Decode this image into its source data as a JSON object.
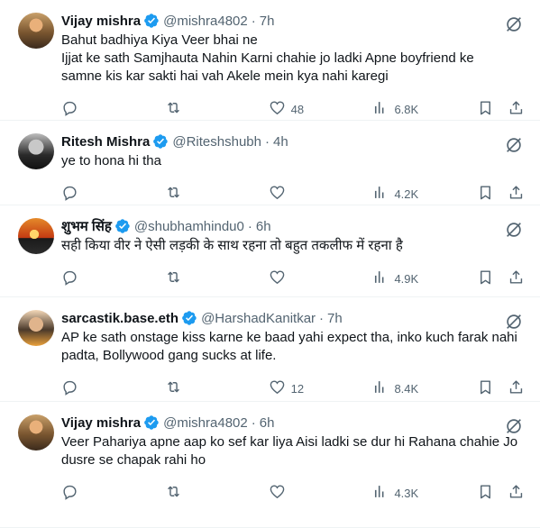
{
  "colors": {
    "accent": "#1d9bf0",
    "muted": "#536471",
    "text": "#0f1419",
    "divider": "#eff3f4"
  },
  "tweets": [
    {
      "name": "Vijay mishra",
      "handle": "@mishra4802",
      "dot": "·",
      "time": "7h",
      "lines": [
        "Bahut badhiya Kiya Veer bhai ne",
        "Ijjat ke sath Samjhauta Nahin Karni chahie jo ladki Apne boyfriend ke",
        "samne kis kar sakti hai vah Akele mein kya nahi karegi"
      ],
      "likes": "48",
      "views": "6.8K"
    },
    {
      "name": "Ritesh Mishra",
      "handle": "@Riteshshubh",
      "dot": "·",
      "time": "4h",
      "lines": [
        "ye to hona hi tha"
      ],
      "likes": "",
      "views": "4.2K"
    },
    {
      "name": "शुभम सिंह",
      "handle": "@shubhamhindu0",
      "dot": "·",
      "time": "6h",
      "lines": [
        "सही किया वीर ने ऐसी लड़की के साथ रहना तो बहुत तकलीफ में रहना है"
      ],
      "likes": "",
      "views": "4.9K"
    },
    {
      "name": "sarcastik.base.eth",
      "handle": "@HarshadKanitkar",
      "dot": "·",
      "time": "7h",
      "lines": [
        "AP ke sath onstage kiss karne ke baad yahi expect tha, inko kuch farak nahi",
        "padta, Bollywood gang sucks at life."
      ],
      "likes": "12",
      "views": "8.4K"
    },
    {
      "name": "Vijay mishra",
      "handle": "@mishra4802",
      "dot": "·",
      "time": "6h",
      "lines": [
        "Veer Pahariya apne aap ko sef kar liya Aisi ladki se dur hi Rahana chahie Jo",
        "dusre se chapak rahi ho"
      ],
      "likes": "",
      "views": "4.3K"
    }
  ]
}
